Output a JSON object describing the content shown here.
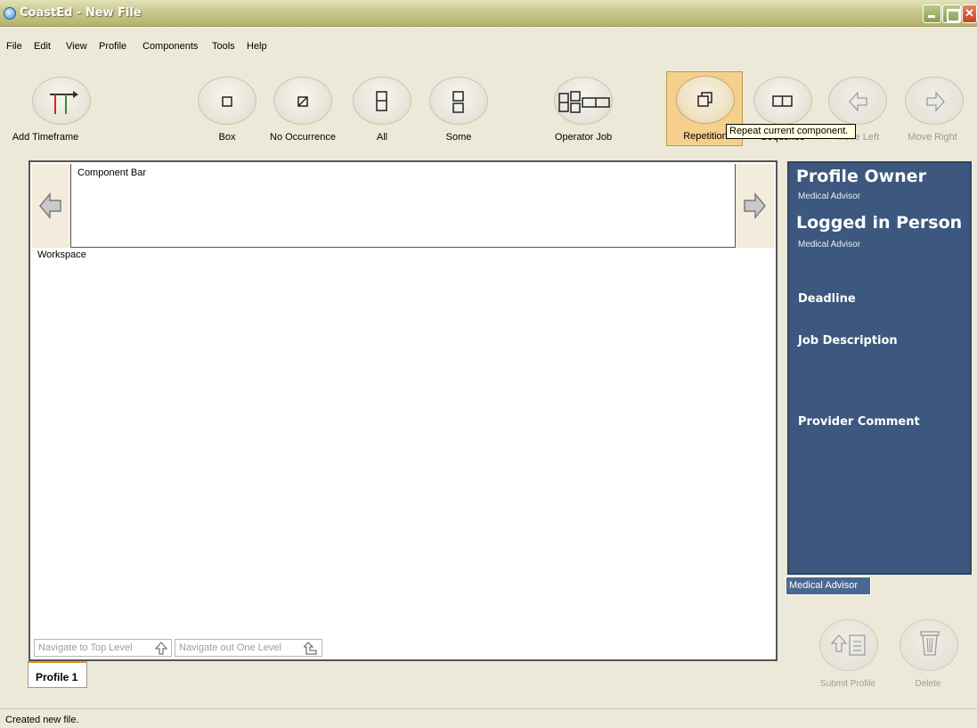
{
  "window": {
    "title": "CoastEd - New File"
  },
  "menu": [
    "File",
    "Edit",
    "View",
    "Profile",
    "Components",
    "Tools",
    "Help"
  ],
  "toolbar": {
    "add_timeframe": "Add Timeframe",
    "box": "Box",
    "no_occurrence": "No Occurrence",
    "all": "All",
    "some": "Some",
    "operator_job": "Operator Job",
    "repetition": "Repetition",
    "sequence": "Sequence",
    "move_left": "Move Left",
    "move_right": "Move Right"
  },
  "tooltip": "Repeat current component.",
  "component_bar": {
    "label": "Component Bar"
  },
  "workspace": {
    "label": "Workspace"
  },
  "navigation": {
    "top_level": "Navigate to Top Level",
    "out_one_level": "Navigate out One Level"
  },
  "tabs": {
    "profile": "Profile 1"
  },
  "side_panel": {
    "profile_owner_heading": "Profile Owner",
    "profile_owner_value": "Medical Advisor",
    "logged_in_heading": "Logged in Person",
    "logged_in_value": "Medical Advisor",
    "deadline": "Deadline",
    "job_description": "Job Description",
    "provider_comment": "Provider Comment",
    "tab_label": "Medical Advisor"
  },
  "actions": {
    "submit": "Submit Profile",
    "delete": "Delete"
  },
  "status": "Created new file.",
  "colors": {
    "panel": "#3d587e",
    "active_tool": "#f5d08c",
    "timeframe_red": "#cc2a2a",
    "timeframe_green": "#2f8f2f"
  }
}
